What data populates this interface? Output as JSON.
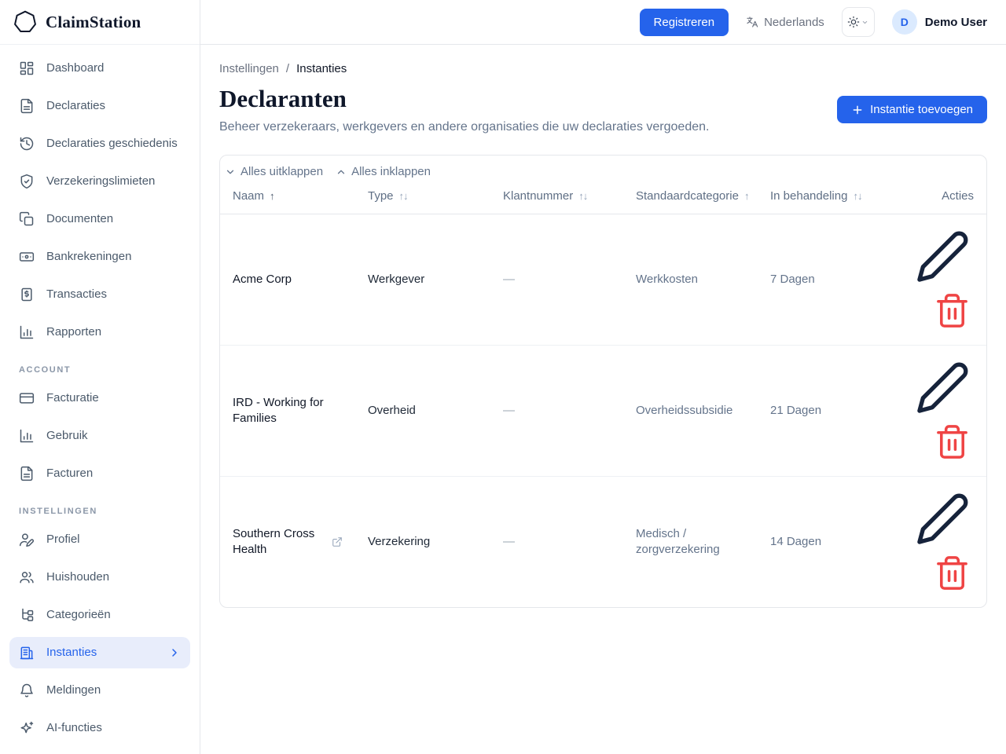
{
  "brand": {
    "name": "ClaimStation",
    "logo_icon": "heptagon-outline-icon"
  },
  "header": {
    "register_button": "Registreren",
    "language_label": "Nederlands",
    "language_icon": "translate-icon",
    "theme_icon": "sun-icon",
    "user_initial": "D",
    "user_name": "Demo User"
  },
  "sidebar": {
    "main_items": [
      {
        "label": "Dashboard",
        "icon": "dashboard-icon"
      },
      {
        "label": "Declaraties",
        "icon": "document-icon"
      },
      {
        "label": "Declaraties geschiedenis",
        "icon": "history-icon"
      },
      {
        "label": "Verzekeringslimieten",
        "icon": "shield-check-icon"
      },
      {
        "label": "Documenten",
        "icon": "documents-icon"
      },
      {
        "label": "Bankrekeningen",
        "icon": "banknote-icon"
      },
      {
        "label": "Transacties",
        "icon": "receipt-icon"
      },
      {
        "label": "Rapporten",
        "icon": "bar-chart-icon"
      }
    ],
    "account_section_label": "ACCOUNT",
    "account_items": [
      {
        "label": "Facturatie",
        "icon": "credit-card-icon"
      },
      {
        "label": "Gebruik",
        "icon": "bar-chart-icon"
      },
      {
        "label": "Facturen",
        "icon": "document-icon"
      }
    ],
    "settings_section_label": "INSTELLINGEN",
    "settings_items": [
      {
        "label": "Profiel",
        "icon": "user-pen-icon"
      },
      {
        "label": "Huishouden",
        "icon": "users-icon"
      },
      {
        "label": "Categorieën",
        "icon": "category-tree-icon"
      },
      {
        "label": "Instanties",
        "icon": "building-icon",
        "active": true
      },
      {
        "label": "Meldingen",
        "icon": "bell-icon"
      },
      {
        "label": "AI-functies",
        "icon": "sparkles-icon"
      }
    ]
  },
  "breadcrumb": {
    "parent": "Instellingen",
    "separator": "/",
    "current": "Instanties"
  },
  "page": {
    "title": "Declaranten",
    "subtitle": "Beheer verzekeraars, werkgevers en andere organisaties die uw declaraties vergoeden.",
    "add_button": "Instantie toevoegen"
  },
  "table": {
    "expand_all_label": "Alles uitklappen",
    "collapse_all_label": "Alles inklappen",
    "columns": [
      {
        "label": "Naam",
        "sort_glyph": "↑",
        "sorted": "asc"
      },
      {
        "label": "Type",
        "sort_glyph": "↑↓",
        "sorted": "none"
      },
      {
        "label": "Klantnummer",
        "sort_glyph": "↑↓",
        "sorted": "none"
      },
      {
        "label": "Standaardcategorie",
        "sort_glyph": "↑",
        "sorted": "none"
      },
      {
        "label": "In behandeling",
        "sort_glyph": "↑↓",
        "sorted": "none"
      },
      {
        "label": "Acties",
        "sort_glyph": "",
        "sorted": "none"
      }
    ],
    "rows": [
      {
        "name": "Acme Corp",
        "type": "Werkgever",
        "klantnummer": "—",
        "standaardcategorie": "Werkkosten",
        "in_behandeling": "7 Dagen",
        "has_external_link": false
      },
      {
        "name": "IRD - Working for Families",
        "type": "Overheid",
        "klantnummer": "—",
        "standaardcategorie": "Overheidssubsidie",
        "in_behandeling": "21 Dagen",
        "has_external_link": false
      },
      {
        "name": "Southern Cross Health",
        "type": "Verzekering",
        "klantnummer": "—",
        "standaardcategorie": "Medisch / zorgverzekering",
        "in_behandeling": "14 Dagen",
        "has_external_link": true
      }
    ]
  },
  "colors": {
    "accent": "#2563eb",
    "accent_soft": "#e8edfb",
    "danger": "#ef4444",
    "text_primary": "#111827",
    "text_muted": "#64748b",
    "border": "#e5e7eb",
    "avatar_bg": "#dbeafe"
  }
}
